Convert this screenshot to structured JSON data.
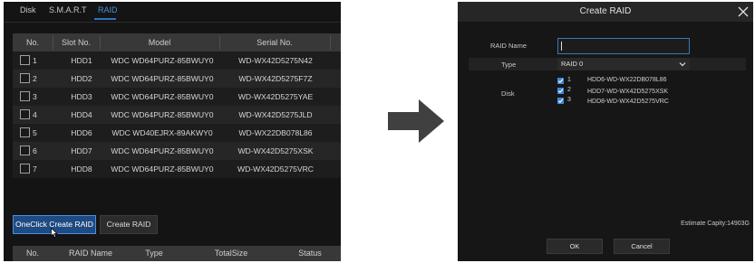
{
  "disk_panel": {
    "tabs": [
      {
        "label": "Disk"
      },
      {
        "label": "S.M.A.R.T"
      },
      {
        "label": "RAID",
        "active": true
      }
    ],
    "columns": [
      "No.",
      "Slot No.",
      "Model",
      "Serial No."
    ],
    "rows": [
      {
        "no": "1",
        "slot": "HDD1",
        "model": "WDC WD64PURZ-85BWUY0",
        "serial": "WD-WX42D5275N42"
      },
      {
        "no": "2",
        "slot": "HDD2",
        "model": "WDC WD64PURZ-85BWUY0",
        "serial": "WD-WX42D5275F7Z"
      },
      {
        "no": "3",
        "slot": "HDD3",
        "model": "WDC WD64PURZ-85BWUY0",
        "serial": "WD-WX42D5275YAE"
      },
      {
        "no": "4",
        "slot": "HDD4",
        "model": "WDC WD64PURZ-85BWUY0",
        "serial": "WD-WX42D5275JLD"
      },
      {
        "no": "5",
        "slot": "HDD6",
        "model": "WDC WD40EJRX-89AKWY0",
        "serial": "WD-WX22DB078L86"
      },
      {
        "no": "6",
        "slot": "HDD7",
        "model": "WDC WD64PURZ-85BWUY0",
        "serial": "WD-WX42D5275XSK"
      },
      {
        "no": "7",
        "slot": "HDD8",
        "model": "WDC WD64PURZ-85BWUY0",
        "serial": "WD-WX42D5275VRC"
      }
    ],
    "buttons": {
      "oneclick_label": "OneClick Create RAID",
      "create_label": "Create RAID"
    },
    "raid_columns": [
      "No.",
      "RAID Name",
      "Type",
      "TotalSize",
      "Status"
    ]
  },
  "create_raid_dialog": {
    "title": "Create RAID",
    "raid_name_label": "RAID Name",
    "raid_name_value": "",
    "type_label": "Type",
    "type_value": "RAID 0",
    "disk_label": "Disk",
    "disks": [
      {
        "num": "1",
        "name": "HDD6-WD-WX22DB078L86",
        "checked": true
      },
      {
        "num": "2",
        "name": "HDD7-WD-WX42D5275XSK",
        "checked": true
      },
      {
        "num": "3",
        "name": "HDD8-WD-WX42D5275VRC",
        "checked": true
      }
    ],
    "estimate_label": "Estimate Capity:14903G",
    "ok_label": "OK",
    "cancel_label": "Cancel"
  },
  "colors": {
    "accent": "#2e72c8",
    "checkbox_checked": "#3e86d6",
    "panel_bg": "#141414",
    "header_bg": "#383838"
  },
  "icons": [
    "close-icon",
    "chevron-down-icon",
    "checkbox-check-icon",
    "arrow-right-icon",
    "mouse-cursor-icon"
  ]
}
